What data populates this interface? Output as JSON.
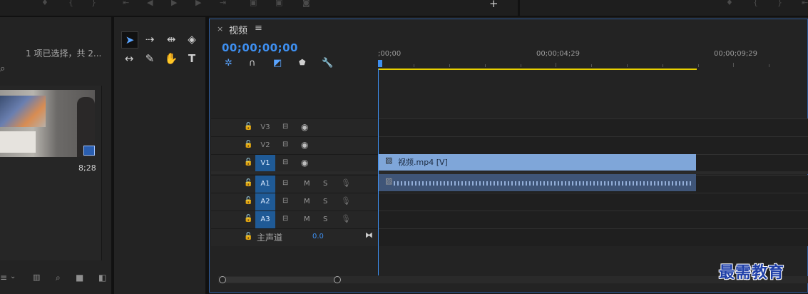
{
  "project": {
    "selection_text": "1 项已选择，共 2...",
    "clip_duration": "8;28"
  },
  "timeline": {
    "close_glyph": "×",
    "sequence_name": "视频",
    "menu_glyph": "≡",
    "timecode": "00;00;00;00",
    "ruler_labels": [
      ";00;00",
      "00;00;04;29",
      "00;00;09;29"
    ],
    "tracks": [
      {
        "name": "V3",
        "type": "video",
        "targeted": false
      },
      {
        "name": "V2",
        "type": "video",
        "targeted": false
      },
      {
        "name": "V1",
        "type": "video",
        "targeted": true
      },
      {
        "name": "A1",
        "type": "audio",
        "targeted": true,
        "mute": "M",
        "solo": "S"
      },
      {
        "name": "A2",
        "type": "audio",
        "targeted": true,
        "mute": "M",
        "solo": "S"
      },
      {
        "name": "A3",
        "type": "audio",
        "targeted": true,
        "mute": "M",
        "solo": "S"
      }
    ],
    "video_clip_label": "视频.mp4 [V]",
    "master_label": "主声道",
    "master_value": "0.0"
  },
  "icons": {
    "selection_tool": "selection-tool-icon",
    "track_select": "track-select-icon",
    "ripple": "ripple-edit-icon",
    "razor": "razor-icon",
    "slip": "slip-icon",
    "pen": "pen-icon",
    "hand": "hand-icon",
    "type": "type-icon"
  },
  "watermark": "最需教育",
  "colors": {
    "accent": "#3e8ff0",
    "work_area": "#e7d000",
    "video_clip": "#7fa6d9",
    "audio_clip": "#3f5578",
    "targeted_track": "#1f5a96"
  }
}
